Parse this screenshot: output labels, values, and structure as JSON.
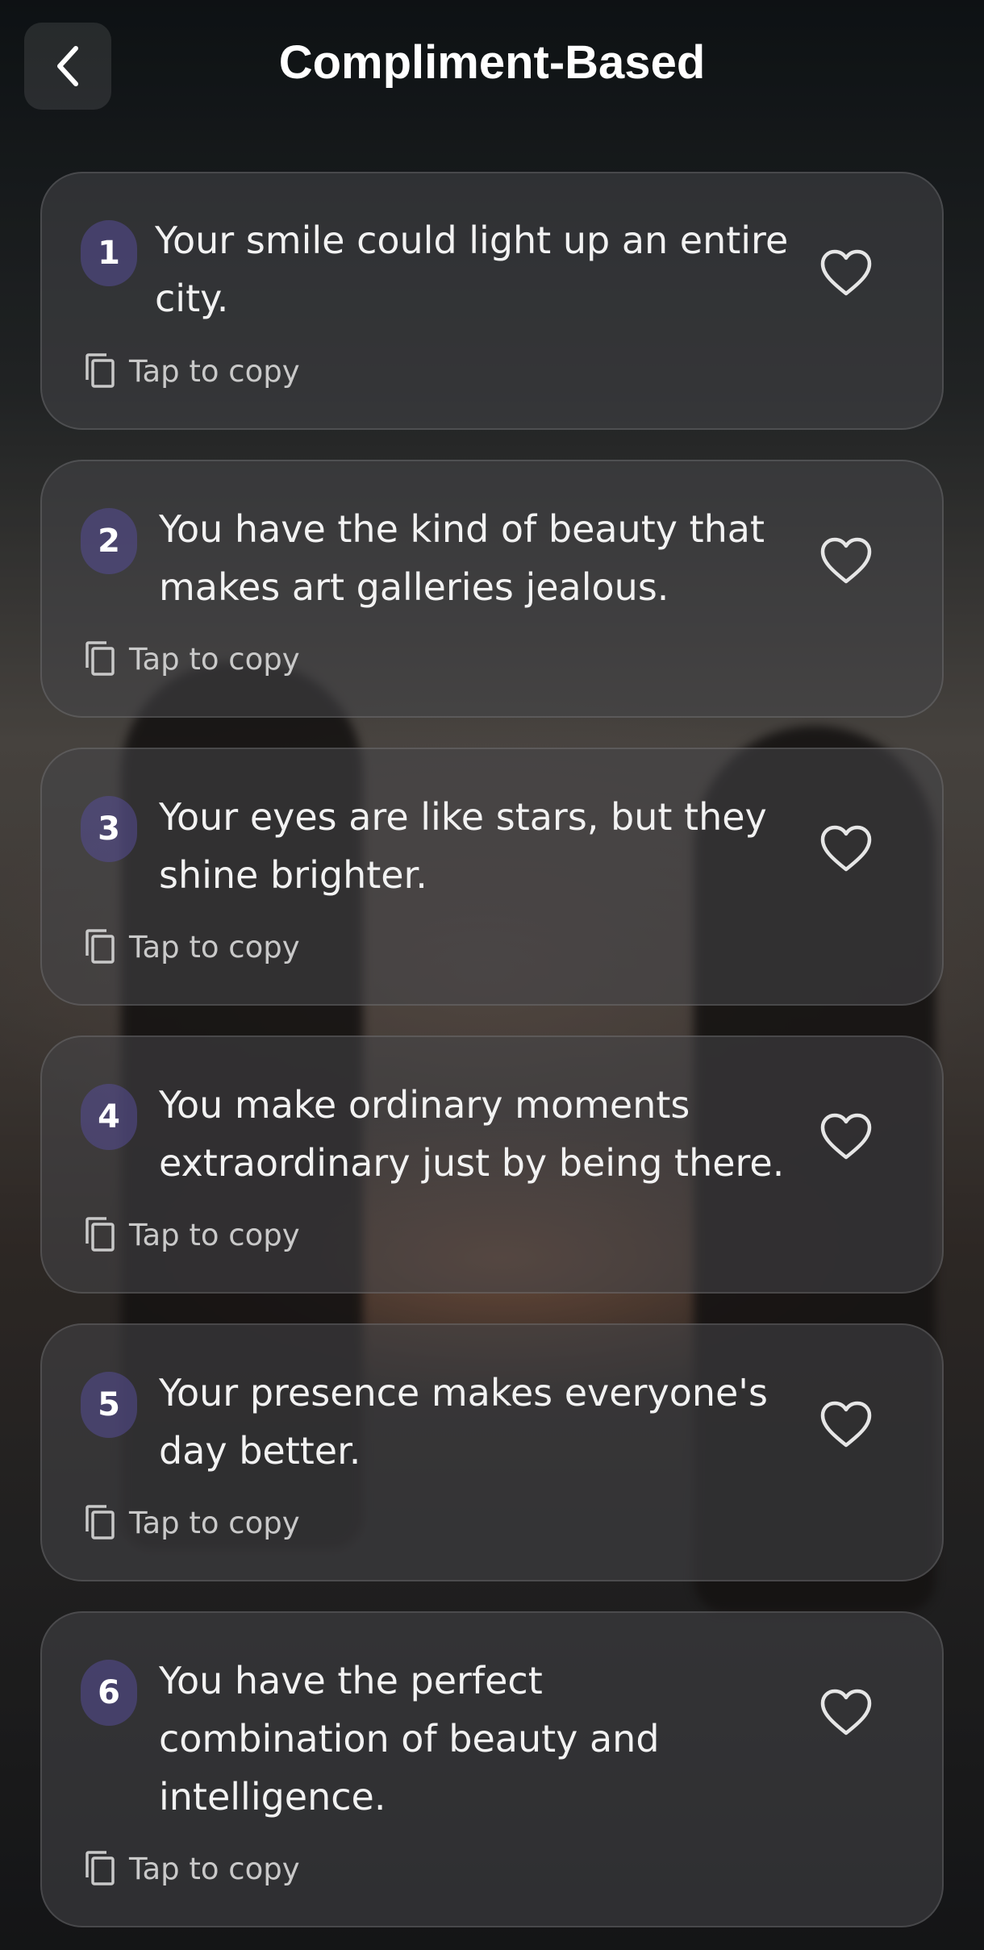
{
  "header": {
    "title": "Compliment-Based",
    "back_icon": "chevron-left-icon"
  },
  "items": [
    {
      "number": "1",
      "text": "Your smile could light up an entire city.",
      "copy_label": "Tap to copy",
      "liked": false
    },
    {
      "number": "2",
      "text": "You have the kind of beauty that makes art galleries jealous.",
      "copy_label": "Tap to copy",
      "liked": false
    },
    {
      "number": "3",
      "text": "Your eyes are like stars, but they shine brighter.",
      "copy_label": "Tap to copy",
      "liked": false
    },
    {
      "number": "4",
      "text": "You make ordinary moments extraordinary just by being there.",
      "copy_label": "Tap to copy",
      "liked": false
    },
    {
      "number": "5",
      "text": "Your presence makes everyone's day better.",
      "copy_label": "Tap to copy",
      "liked": false
    },
    {
      "number": "6",
      "text": "You have the perfect combination of beauty and intelligence.",
      "copy_label": "Tap to copy",
      "liked": false
    }
  ],
  "colors": {
    "badge": "#4b4390",
    "text": "#f2f2f2",
    "muted": "#c9c9c9"
  }
}
